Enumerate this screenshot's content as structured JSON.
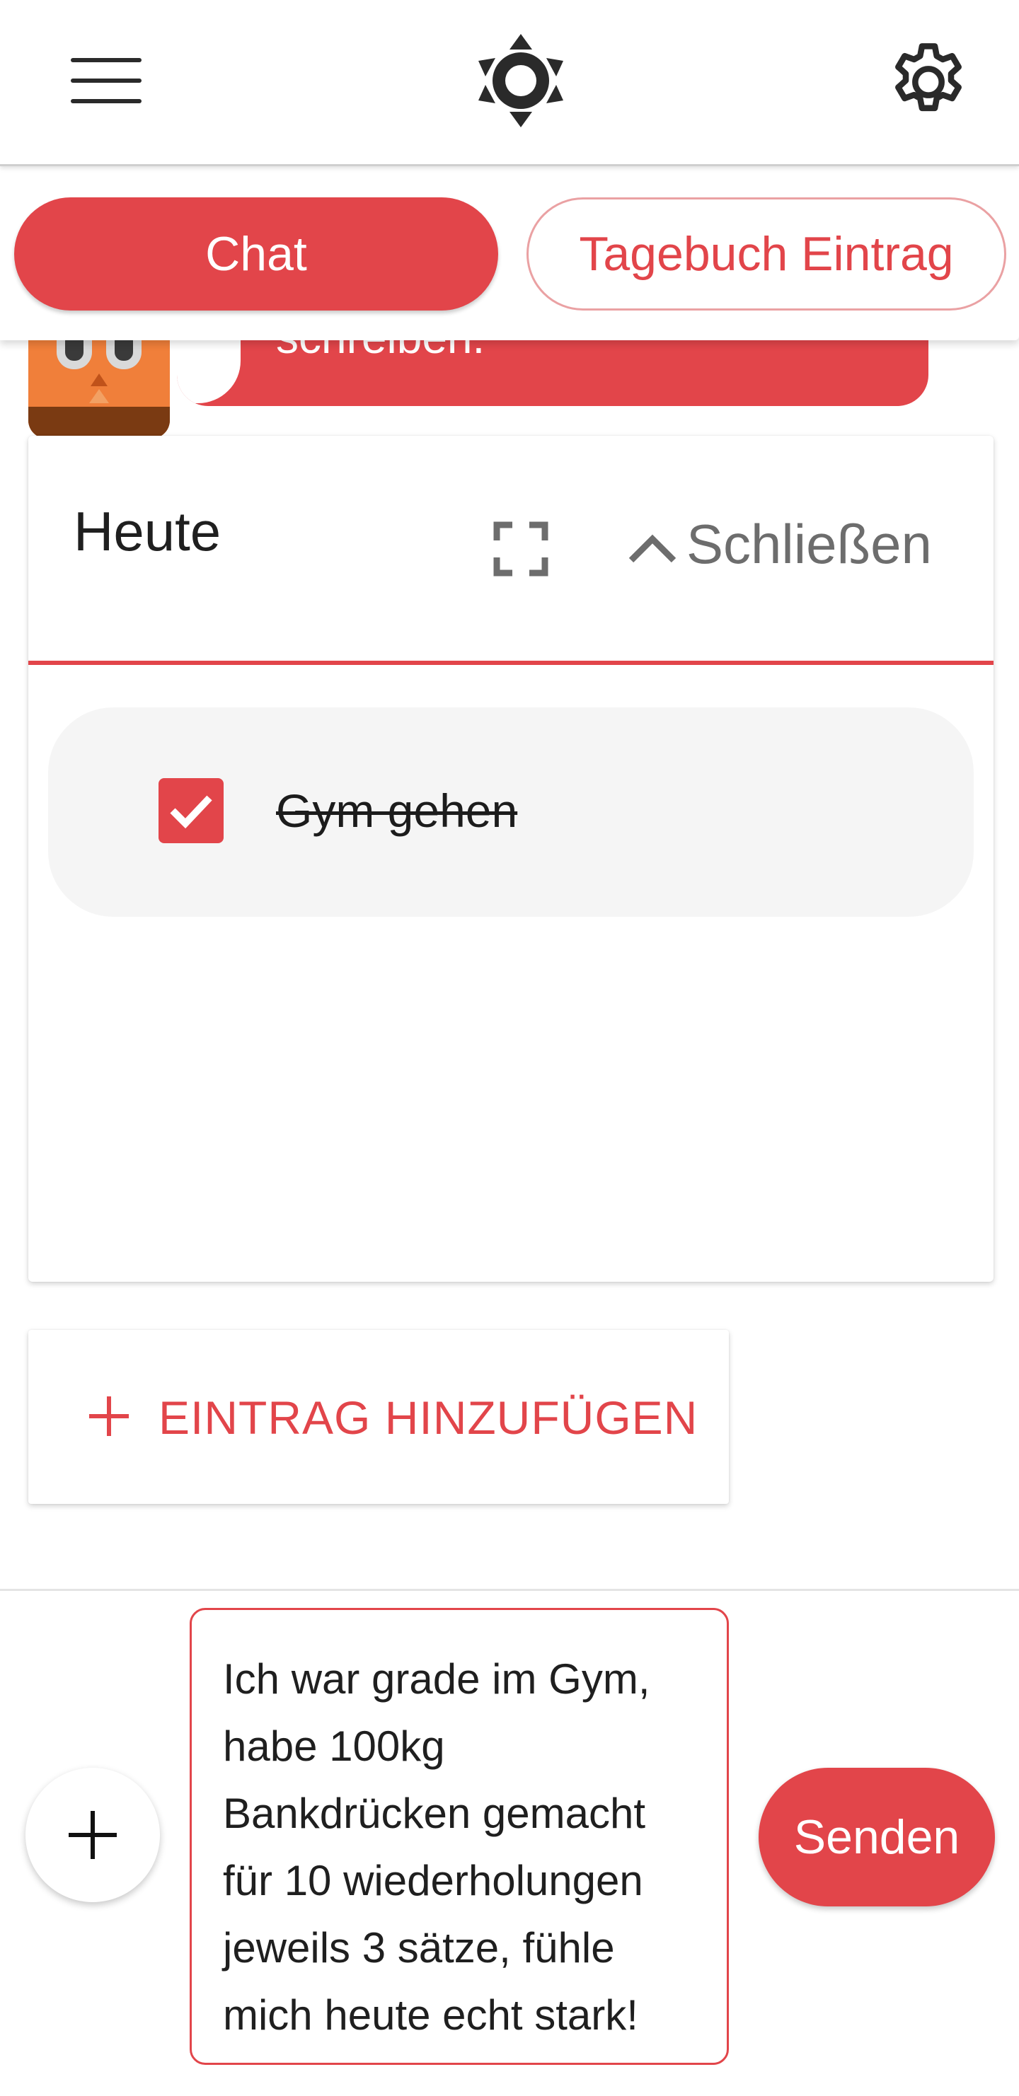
{
  "header": {
    "menu_icon": "hamburger-menu-icon",
    "theme_icon": "brightness-icon",
    "settings_icon": "gear-icon"
  },
  "mode_switch": {
    "active_label": "Chat",
    "inactive_label": "Tagebuch Eintrag"
  },
  "chat": {
    "bubble_text": "schreiben.",
    "avatar": "owl-avatar"
  },
  "journal_card": {
    "title": "Heute",
    "expand_icon": "fullscreen-icon",
    "collapse_icon": "chevron-up-icon",
    "close_label": "Schließen",
    "tasks": [
      {
        "label": "Gym gehen",
        "checked": true
      }
    ]
  },
  "add_entry": {
    "label": "EINTRAG HINZUFÜGEN"
  },
  "composer": {
    "message_value": "Ich war grade im Gym, habe 100kg Bankdrücken gemacht für 10 wiederholungen jeweils 3 sätze, fühle mich heute echt stark!",
    "send_label": "Senden"
  },
  "colors": {
    "accent": "#e2454a",
    "muted_text": "#6d6d6d"
  }
}
